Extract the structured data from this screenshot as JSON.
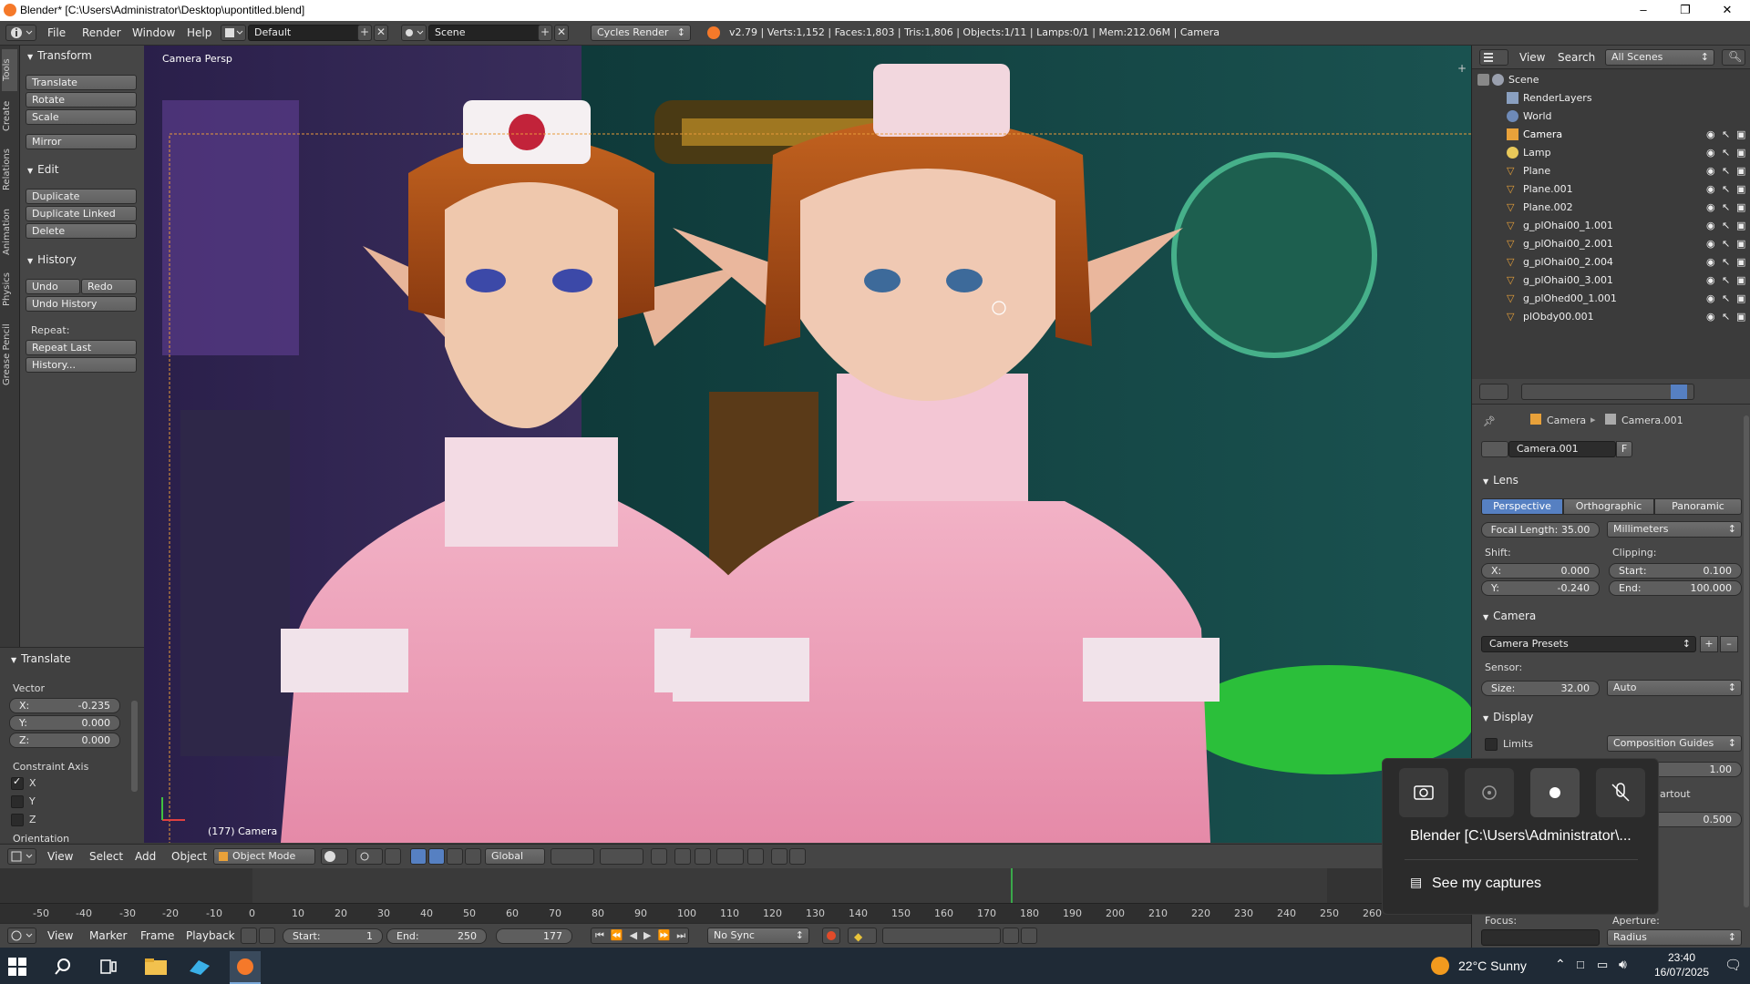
{
  "window": {
    "title": "Blender* [C:\\Users\\Administrator\\Desktop\\upontitled.blend]",
    "minimize": "–",
    "maximize": "❐",
    "close": "✕"
  },
  "header": {
    "menus": [
      "File",
      "Render",
      "Window",
      "Help"
    ],
    "screen_layout": "Default",
    "scene": "Scene",
    "render_engine": "Cycles Render",
    "stats": "v2.79 | Verts:1,152 | Faces:1,803 | Tris:1,806 | Objects:1/11 | Lamps:0/1 | Mem:212.06M | Camera"
  },
  "tool_tabs": [
    "Tools",
    "Create",
    "Relations",
    "Animation",
    "Physics",
    "Grease Pencil"
  ],
  "tool_shelf": {
    "transform": {
      "title": "Transform",
      "buttons": [
        "Translate",
        "Rotate",
        "Scale",
        "Mirror"
      ]
    },
    "edit": {
      "title": "Edit",
      "buttons": [
        "Duplicate",
        "Duplicate Linked",
        "Delete"
      ]
    },
    "history": {
      "title": "History",
      "undo": "Undo",
      "redo": "Redo",
      "undo_history": "Undo History",
      "repeat_label": "Repeat:",
      "repeat_last": "Repeat Last",
      "history_btn": "History..."
    },
    "operator": {
      "title": "Translate",
      "vector_label": "Vector",
      "x_label": "X:",
      "x": "-0.235",
      "y_label": "Y:",
      "y": "0.000",
      "z_label": "Z:",
      "z": "0.000",
      "constraint_label": "Constraint Axis",
      "axes": [
        "X",
        "Y",
        "Z"
      ],
      "axes_checked": [
        true,
        false,
        false
      ],
      "orientation_label": "Orientation"
    }
  },
  "viewport": {
    "view_name": "Camera Persp",
    "object_label": "(177) Camera"
  },
  "viewport_header": {
    "menus": [
      "View",
      "Select",
      "Add",
      "Object"
    ],
    "mode": "Object Mode",
    "orientation": "Global"
  },
  "timeline": {
    "ticks": [
      "-50",
      "-40",
      "-30",
      "-20",
      "-10",
      "0",
      "10",
      "20",
      "30",
      "40",
      "50",
      "60",
      "70",
      "80",
      "90",
      "100",
      "110",
      "120",
      "130",
      "140",
      "150",
      "160",
      "170",
      "180",
      "190",
      "200",
      "210",
      "220",
      "230",
      "240",
      "250",
      "260"
    ],
    "current_frame": 177,
    "menus": [
      "View",
      "Marker",
      "Frame",
      "Playback"
    ],
    "start_label": "Start:",
    "start": "1",
    "end_label": "End:",
    "end": "250",
    "frame": "177",
    "sync": "No Sync"
  },
  "outliner": {
    "menus": [
      "View",
      "Search"
    ],
    "filter": "All Scenes",
    "items": [
      {
        "name": "Scene",
        "level": 0,
        "type": "scene"
      },
      {
        "name": "RenderLayers",
        "level": 1,
        "type": "layers"
      },
      {
        "name": "World",
        "level": 1,
        "type": "world"
      },
      {
        "name": "Camera",
        "level": 1,
        "type": "camera",
        "selected": true
      },
      {
        "name": "Lamp",
        "level": 1,
        "type": "lamp"
      },
      {
        "name": "Plane",
        "level": 1,
        "type": "mesh"
      },
      {
        "name": "Plane.001",
        "level": 1,
        "type": "mesh"
      },
      {
        "name": "Plane.002",
        "level": 1,
        "type": "mesh"
      },
      {
        "name": "g_plOhai00_1.001",
        "level": 1,
        "type": "mesh"
      },
      {
        "name": "g_plOhai00_2.001",
        "level": 1,
        "type": "mesh"
      },
      {
        "name": "g_plOhai00_2.004",
        "level": 1,
        "type": "mesh"
      },
      {
        "name": "g_plOhai00_3.001",
        "level": 1,
        "type": "mesh"
      },
      {
        "name": "g_plOhed00_1.001",
        "level": 1,
        "type": "mesh"
      },
      {
        "name": "plObdy00.001",
        "level": 1,
        "type": "mesh"
      }
    ]
  },
  "properties": {
    "breadcrumb_object": "Camera",
    "breadcrumb_data": "Camera.001",
    "datablock": "Camera.001",
    "fake_user": "F",
    "lens": {
      "title": "Lens",
      "types": [
        "Perspective",
        "Orthographic",
        "Panoramic"
      ],
      "active_type": "Perspective",
      "focal_length": "Focal Length: 35.00",
      "lens_unit": "Millimeters",
      "shift_label": "Shift:",
      "shift_x_label": "X:",
      "shift_x": "0.000",
      "shift_y_label": "Y:",
      "shift_y": "-0.240",
      "clipping_label": "Clipping:",
      "clip_start_label": "Start:",
      "clip_start": "0.100",
      "clip_end_label": "End:",
      "clip_end": "100.000"
    },
    "camera": {
      "title": "Camera",
      "presets": "Camera Presets",
      "sensor_label": "Sensor:",
      "size_label": "Size:",
      "size": "32.00",
      "fit": "Auto"
    },
    "display": {
      "title": "Display",
      "limits": "Limits",
      "guides": "Composition Guides",
      "value1": "1.00",
      "passepartout_partial": "artout",
      "value2": "0.500"
    },
    "dof": {
      "focus_label": "Focus:",
      "aperture_label": "Aperture:",
      "aperture_type": "Radius"
    }
  },
  "capture_popup": {
    "window_name": "Blender [C:\\Users\\Administrator\\...",
    "see_captures": "See my captures"
  },
  "taskbar": {
    "weather": "22°C  Sunny",
    "time": "23:40",
    "date": "16/07/2025"
  },
  "colors": {
    "accent": "#5680c2",
    "frame_line": "#3aa84a",
    "camera_border": "#e89a3a"
  }
}
